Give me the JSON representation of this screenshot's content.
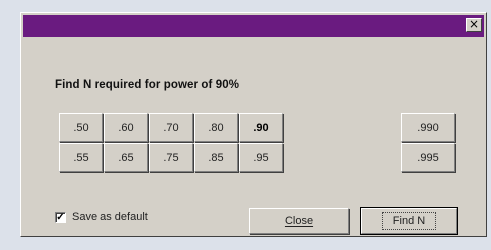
{
  "dialog": {
    "close_glyph": "×",
    "prompt": "Find N required for power of 90%",
    "power_grid": {
      "rows": [
        [
          ".50",
          ".60",
          ".70",
          ".80",
          ".90"
        ],
        [
          ".55",
          ".65",
          ".75",
          ".85",
          ".95"
        ]
      ],
      "extra": [
        ".990",
        ".995"
      ],
      "selected": ".90"
    },
    "save_default": {
      "label": "Save as default",
      "checked": true,
      "check_glyph": "✓"
    },
    "buttons": {
      "close": "Close",
      "find": "Find N"
    }
  },
  "colors": {
    "titlebar": "#6a1b80",
    "face": "#d4d0c8",
    "background": "#dce1ea"
  }
}
